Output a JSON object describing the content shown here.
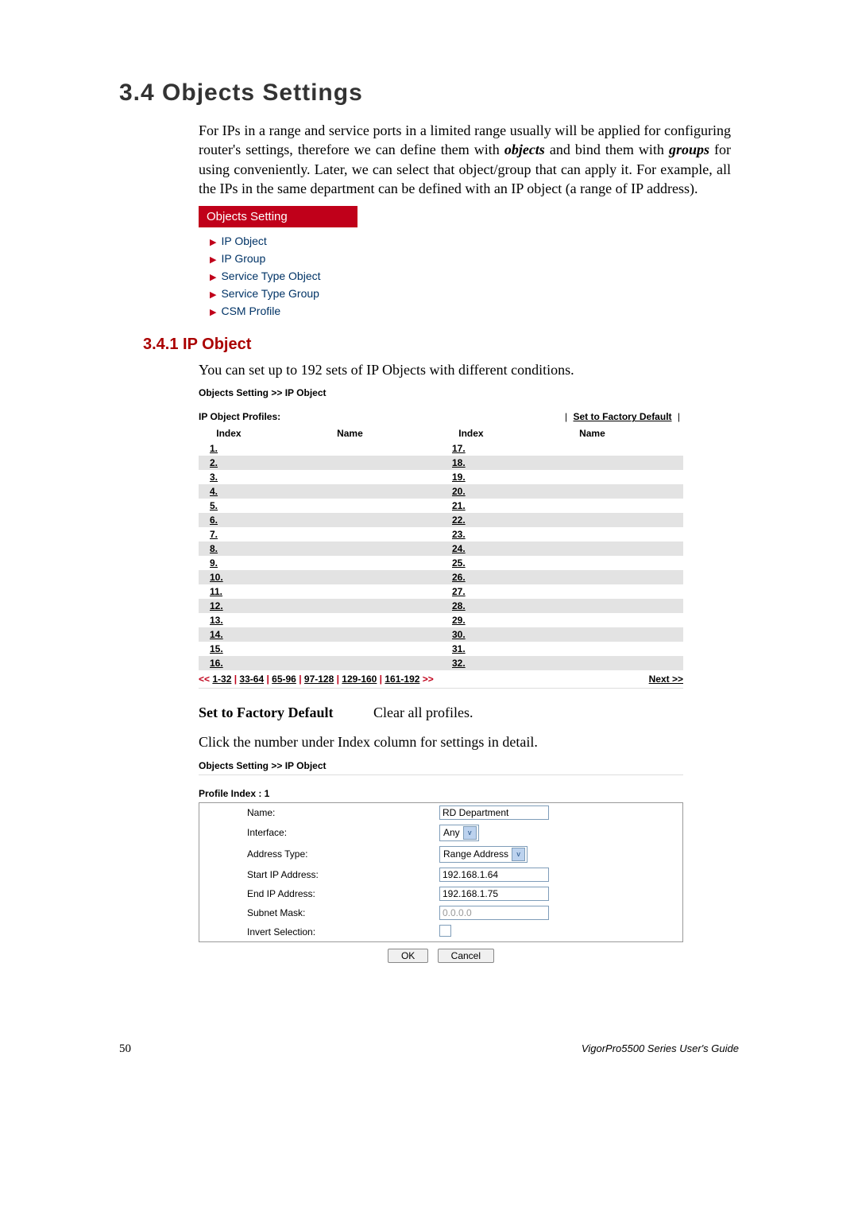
{
  "section": {
    "title": "3.4 Objects Settings",
    "intro_prefix": "For IPs in a range and service ports in a limited range usually will be applied for configuring router's settings, therefore we can define them with ",
    "intro_obj": "objects",
    "intro_mid": " and bind them with ",
    "intro_grp": "groups",
    "intro_suffix": " for using conveniently. Later, we can select that object/group that can apply it. For example, all the IPs in the same department can be defined with an IP object (a range of IP address)."
  },
  "menu": {
    "header": "Objects Setting",
    "items": [
      "IP Object",
      "IP Group",
      "Service Type Object",
      "Service Type Group",
      "CSM Profile"
    ]
  },
  "sub": {
    "title": "3.4.1 IP Object",
    "desc": "You can set up to 192 sets of IP Objects with different conditions."
  },
  "shot1": {
    "breadcrumb": "Objects Setting >> IP Object",
    "profiles_label": "IP Object Profiles:",
    "factory_default": "Set to Factory Default",
    "col_index": "Index",
    "col_name": "Name",
    "rows_left": [
      "1.",
      "2.",
      "3.",
      "4.",
      "5.",
      "6.",
      "7.",
      "8.",
      "9.",
      "10.",
      "11.",
      "12.",
      "13.",
      "14.",
      "15.",
      "16."
    ],
    "rows_right": [
      "17.",
      "18.",
      "19.",
      "20.",
      "21.",
      "22.",
      "23.",
      "24.",
      "25.",
      "26.",
      "27.",
      "28.",
      "29.",
      "30.",
      "31.",
      "32."
    ],
    "pager_prev": "<<",
    "pager_ranges": [
      "1-32",
      "33-64",
      "65-96",
      "97-128",
      "129-160",
      "161-192"
    ],
    "pager_dbl": ">>",
    "pager_next": "Next >>"
  },
  "definition": {
    "label": "Set to Factory Default",
    "value": "Clear all profiles."
  },
  "click_text": "Click the number under Index column for settings in detail.",
  "shot2": {
    "breadcrumb": "Objects Setting >> IP Object",
    "profile_index": "Profile Index : 1",
    "fields": {
      "name_label": "Name:",
      "name_value": "RD Department",
      "interface_label": "Interface:",
      "interface_value": "Any",
      "addrtype_label": "Address Type:",
      "addrtype_value": "Range Address",
      "startip_label": "Start IP Address:",
      "startip_value": "192.168.1.64",
      "endip_label": "End IP Address:",
      "endip_value": "192.168.1.75",
      "subnet_label": "Subnet Mask:",
      "subnet_value": "0.0.0.0",
      "invert_label": "Invert Selection:"
    },
    "ok": "OK",
    "cancel": "Cancel"
  },
  "footer": {
    "page": "50",
    "guide": "VigorPro5500 Series User's Guide"
  }
}
